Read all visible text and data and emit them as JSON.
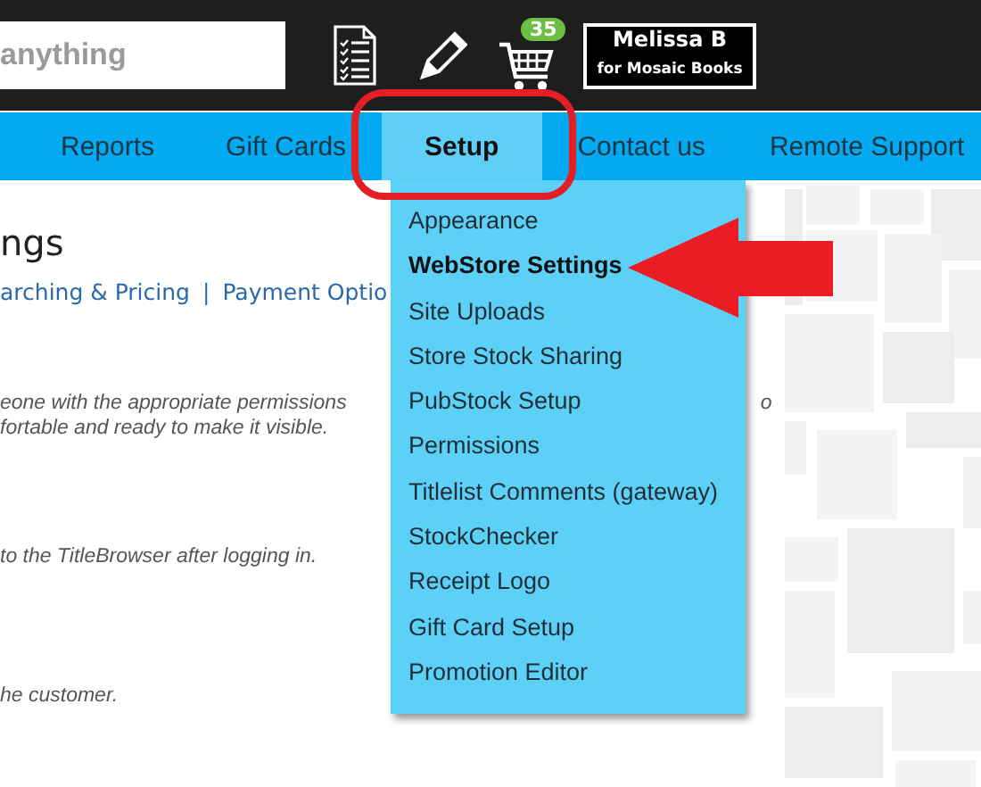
{
  "search": {
    "placeholder": "anything"
  },
  "cart": {
    "badge": "35"
  },
  "user": {
    "name": "Melissa B",
    "store": "for Mosaic Books"
  },
  "nav": [
    {
      "label": "Reports",
      "selected": false
    },
    {
      "label": "Gift Cards",
      "selected": false
    },
    {
      "label": "Setup",
      "selected": true
    },
    {
      "label": "Contact us",
      "selected": false
    },
    {
      "label": "Remote Support",
      "selected": false
    }
  ],
  "setup_menu": [
    {
      "label": "Appearance",
      "selected": false
    },
    {
      "label": "WebStore Settings",
      "selected": true
    },
    {
      "label": "Site Uploads",
      "selected": false
    },
    {
      "label": "Store Stock Sharing",
      "selected": false
    },
    {
      "label": "PubStock Setup",
      "selected": false
    },
    {
      "label": "Permissions",
      "selected": false
    },
    {
      "label": "Titlelist Comments (gateway)",
      "selected": false
    },
    {
      "label": "StockChecker",
      "selected": false
    },
    {
      "label": "Receipt Logo",
      "selected": false
    },
    {
      "label": "Gift Card Setup",
      "selected": false
    },
    {
      "label": "Promotion Editor",
      "selected": false
    }
  ],
  "page": {
    "title": "ngs",
    "links": [
      "arching & Pricing",
      "Payment Optio"
    ],
    "separator": "|",
    "notes": [
      {
        "lines": [
          "eone with the appropriate permissions",
          "fortable and ready to make it visible."
        ],
        "tail": "o"
      },
      {
        "lines": [
          "to the TitleBrowser after logging in."
        ]
      },
      {
        "lines": [
          "he customer."
        ]
      }
    ]
  }
}
